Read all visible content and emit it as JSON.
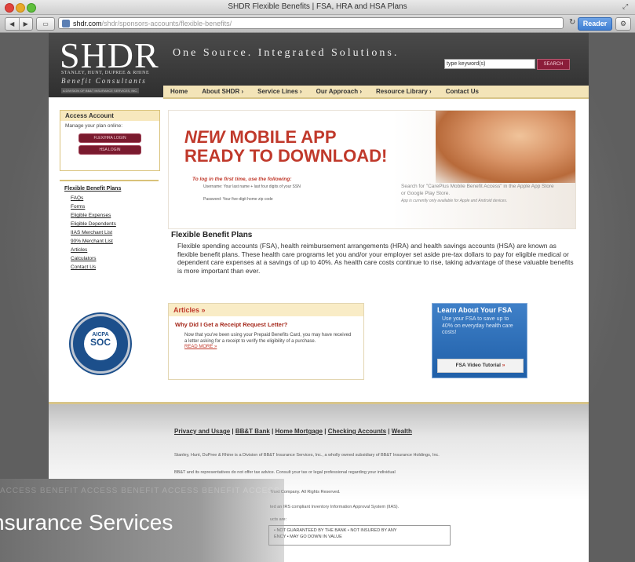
{
  "window": {
    "title": "SHDR Flexible Benefits | FSA, HRA and HSA Plans",
    "url_host": "shdr.com",
    "url_path": "/shdr/sponsors-accounts/flexible-benefits/",
    "reader_label": "Reader"
  },
  "header": {
    "logo": "SHDR",
    "logo_sub1": "STANLEY, HUNT, DUPREE & RHINE",
    "logo_sub2": "Benefit Consultants",
    "logo_sub3": "A DIVISION OF BB&T INSURANCE SERVICES, INC.",
    "tagline": "One Source. Integrated Solutions.",
    "search_value": "type keyword(s)",
    "search_button": "SEARCH"
  },
  "nav": [
    {
      "label": "Home"
    },
    {
      "label": "About SHDR ›"
    },
    {
      "label": "Service Lines ›"
    },
    {
      "label": "Our Approach ›"
    },
    {
      "label": "Resource Library ›"
    },
    {
      "label": "Contact Us"
    }
  ],
  "access": {
    "heading": "Access Account",
    "text": "Manage your plan online:",
    "btn1": "FLEX/HRA LOGIN",
    "btn2": "HSA LOGIN"
  },
  "sidebar": {
    "heading": "Flexible Benefit Plans",
    "items": [
      {
        "label": "FAQs"
      },
      {
        "label": "Forms"
      },
      {
        "label": "Eligible Expenses"
      },
      {
        "label": "Eligible Dependents"
      },
      {
        "label": "IIAS Merchant List"
      },
      {
        "label": "90% Merchant List"
      },
      {
        "label": "Articles"
      },
      {
        "label": "Calculators"
      },
      {
        "label": "Contact Us"
      }
    ]
  },
  "soc": {
    "top": "AICPA",
    "main": "SOC"
  },
  "banner": {
    "line1_new": "NEW",
    "line1_rest": " MOBILE APP",
    "line2": "READY TO DOWNLOAD!",
    "instr": "To log in the first time, use the following:",
    "username": "Username: Your last name + last four digits of your SSN",
    "password": "Password: Your five-digit home zip code",
    "right1": "Search for \"CarePlus Mobile Benefit Access\" in the Apple App Store or Google Play Store.",
    "right2": "App is currently only available for Apple and Android devices."
  },
  "intro": {
    "title": "Flexible Benefit Plans",
    "text": "Flexible spending accounts (FSA), health reimbursement arrangements (HRA) and health savings accounts (HSA) are known as flexible benefit plans. These health care programs let you and/or your employer set aside pre-tax dollars to pay for eligible medical or dependent care expenses at a savings of up to 40%. As health care costs continue to rise, taking advantage of these valuable benefits is more important than ever."
  },
  "articles": {
    "heading": "Articles »",
    "title": "Why Did I Get a Receipt Request Letter?",
    "body": "Now that you've been using your Prepaid Benefits Card, you may have received a letter asking for a receipt to verify the eligibility of a purchase.",
    "more": "READ MORE »"
  },
  "fsa": {
    "heading": "Learn About Your FSA",
    "text": "Use your FSA to save up to 40% on everyday health care costs!",
    "button": "FSA Video Tutorial",
    "button_arrow": "»"
  },
  "footer": {
    "links": [
      "Privacy and Usage",
      "BB&T Bank",
      "Home Mortgage",
      "Checking Accounts",
      "Wealth"
    ],
    "p1": "Stanley, Hunt, DuPree & Rhine is a Division of BB&T Insurance Services, Inc., a wholly owned subsidiary of BB&T Insurance Holdings, Inc.",
    "p2": "BB&T and its representatives do not offer tax advice. Consult your tax or legal professional regarding your individual",
    "p3": "Trust Company. All Rights Reserved.",
    "p4": "ted an IRS compliant Inventory Information Approval System (IIAS).",
    "p5": "ucts are:",
    "box1": "• NOT GUARANTEED BY THE BANK • NOT INSURED BY ANY",
    "box2": "ENCY • MAY GO DOWN IN VALUE"
  },
  "overlay": {
    "repeat": "ACCESS BENEFIT ACCESS BENEFIT ACCESS BENEFIT ACCESS",
    "text": "nsurance Services"
  }
}
